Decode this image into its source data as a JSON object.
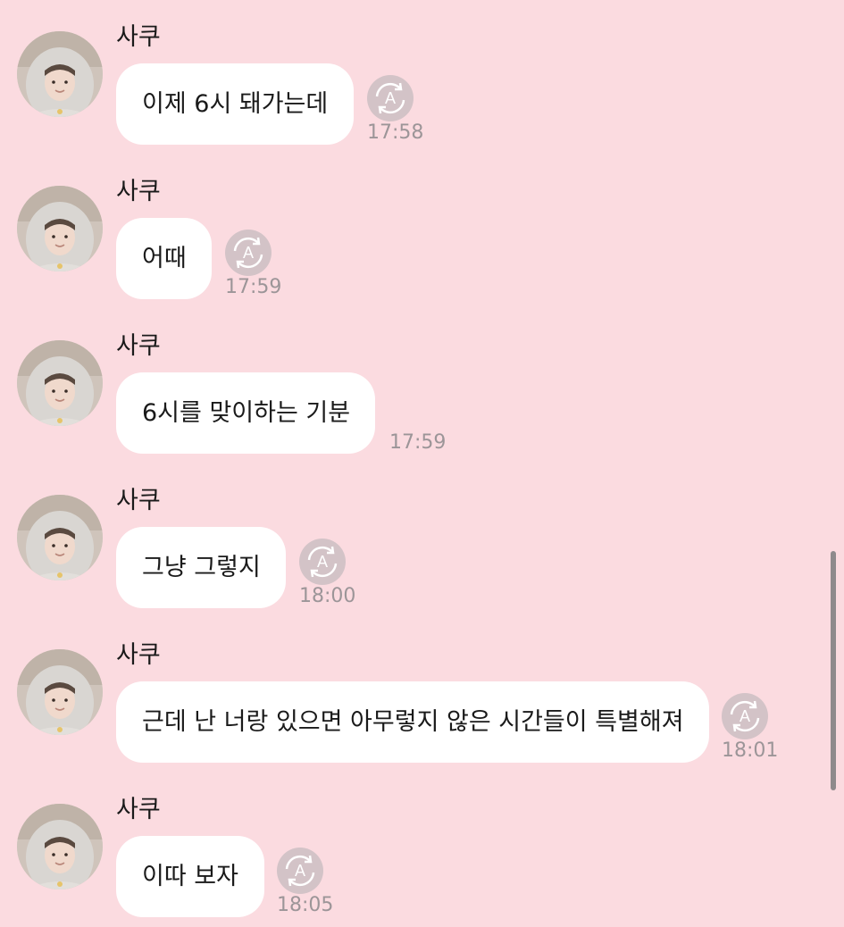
{
  "messages": [
    {
      "sender": "사쿠",
      "text": "이제 6시 돼가는데",
      "time": "17:58",
      "read_icon": "auto-translate-icon"
    },
    {
      "sender": "사쿠",
      "text": "어때",
      "time": "17:59",
      "read_icon": "auto-translate-icon"
    },
    {
      "sender": "사쿠",
      "text": "6시를 맞이하는 기분",
      "time": "17:59",
      "read_icon": null
    },
    {
      "sender": "사쿠",
      "text": "그냥 그렇지",
      "time": "18:00",
      "read_icon": "auto-translate-icon"
    },
    {
      "sender": "사쿠",
      "text": "근데 난 너랑 있으면 아무렇지 않은 시간들이 특별해져",
      "time": "18:01",
      "read_icon": "auto-translate-icon"
    },
    {
      "sender": "사쿠",
      "text": "이따 보자",
      "time": "18:05",
      "read_icon": "auto-translate-icon"
    }
  ],
  "colors": {
    "background": "#fbdbe0",
    "bubble": "#ffffff",
    "time_text": "#9c9598",
    "icon": "#d3c3c7"
  }
}
